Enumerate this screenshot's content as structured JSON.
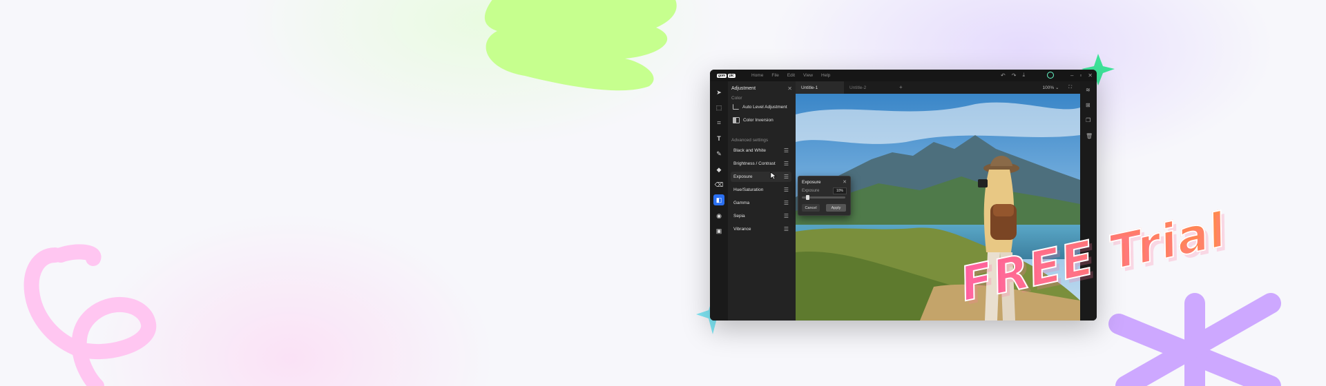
{
  "brand": {
    "logo": "gom",
    "logo_badge": "pic"
  },
  "menu": [
    "Home",
    "File",
    "Edit",
    "View",
    "Help"
  ],
  "panel": {
    "title": "Adjustment",
    "color_section": "Color",
    "color_items": [
      "Auto Level Adjustment",
      "Color Inversion"
    ],
    "advanced_section": "Advanced settings",
    "advanced_items": [
      "Black and White",
      "Brightness / Contrast",
      "Exposure",
      "Hue/Saturation",
      "Gamma",
      "Sepia",
      "Vibrance"
    ],
    "active_item": "Exposure"
  },
  "tabs": {
    "items": [
      "Untitle-1",
      "Untitle-2"
    ],
    "add": "+"
  },
  "zoom": {
    "level": "100%",
    "caret": "⌄"
  },
  "dialog": {
    "title": "Exposure",
    "label": "Exposure",
    "value": "10%",
    "slider_fraction": 0.1,
    "cancel": "Cancel",
    "apply": "Apply"
  },
  "promo": {
    "text": "FREE Trial"
  },
  "colors": {
    "accent": "#2a6ff0",
    "promo_start": "#ff5fa2",
    "promo_end": "#ff8a4d"
  },
  "icons": {
    "tools": [
      "pointer-icon",
      "select-icon",
      "crop-icon",
      "text-icon",
      "brush-icon",
      "fill-icon",
      "eraser-icon",
      "adjustment-icon",
      "sticker-icon",
      "image-edit-icon"
    ],
    "right": [
      "layers-icon",
      "add-layer-icon",
      "duplicate-icon",
      "delete-icon"
    ]
  }
}
